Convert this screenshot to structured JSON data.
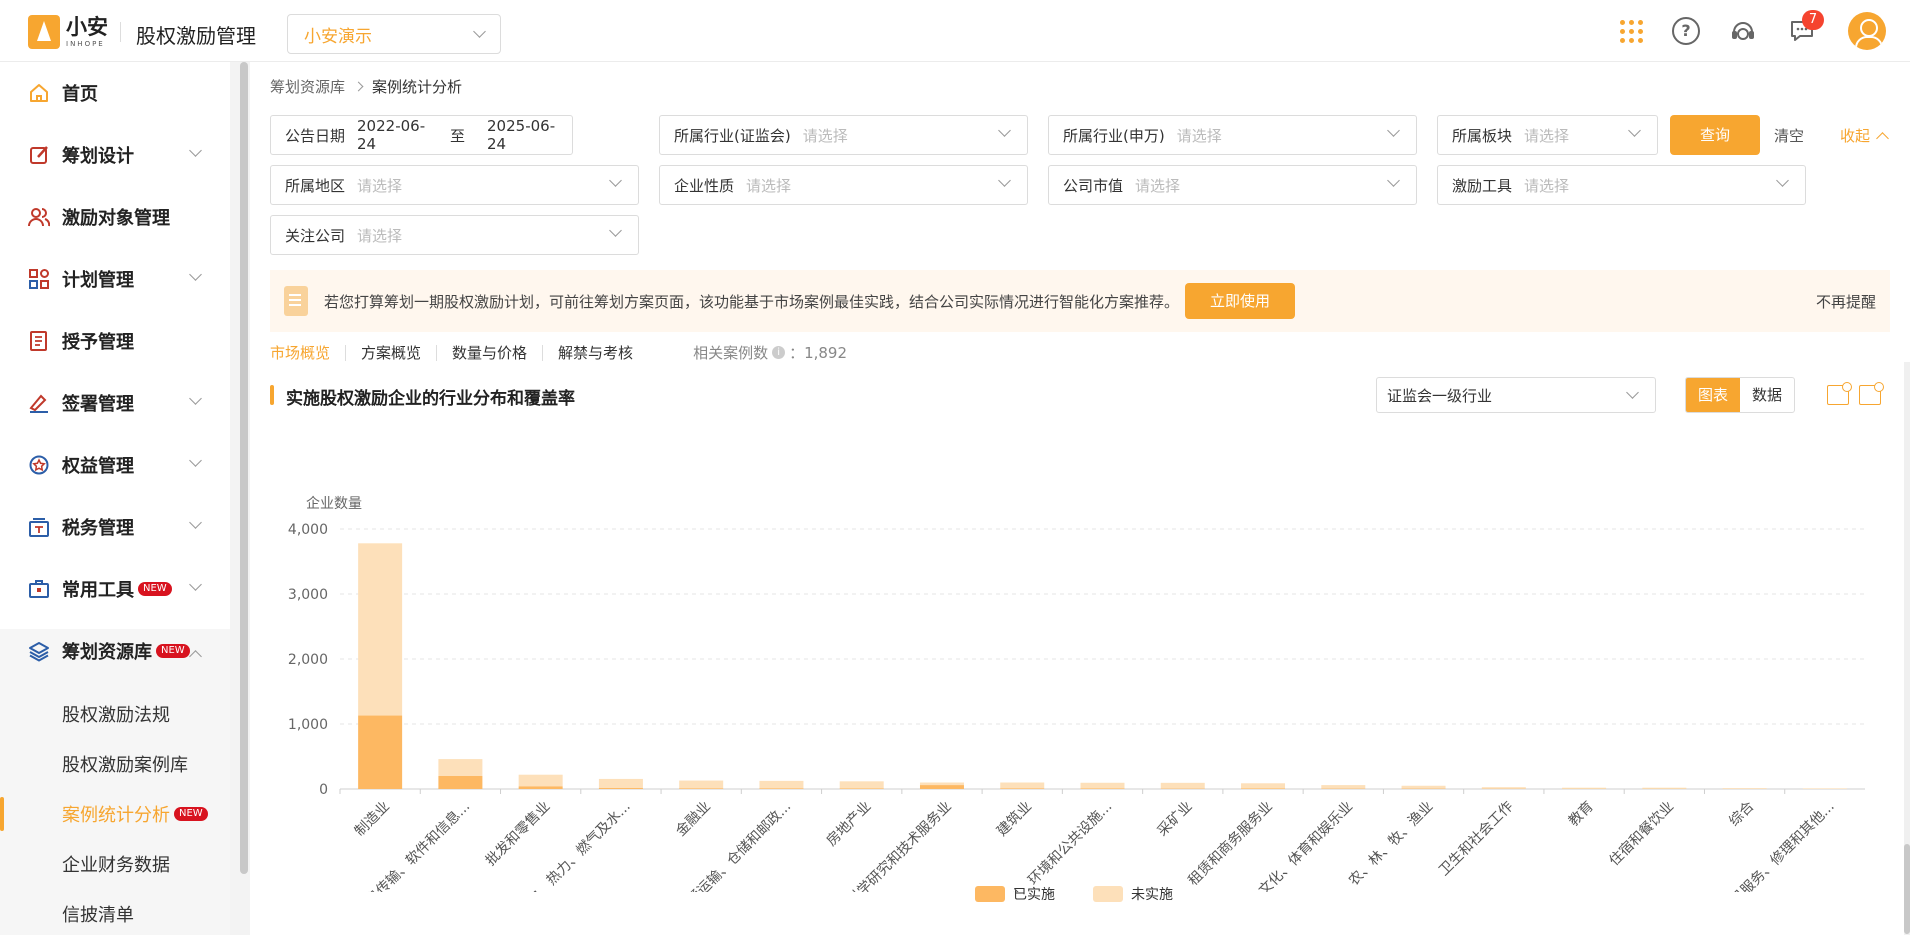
{
  "header": {
    "logo_text": "小安",
    "logo_sub": "INHOPE",
    "app_title": "股权激励管理",
    "company": "小安演示",
    "message_count": "7"
  },
  "sidebar": {
    "items": [
      {
        "label": "首页",
        "icon": "home-icon"
      },
      {
        "label": "筹划设计",
        "icon": "edit-icon"
      },
      {
        "label": "激励对象管理",
        "icon": "users-icon"
      },
      {
        "label": "计划管理",
        "icon": "grid-icon"
      },
      {
        "label": "授予管理",
        "icon": "book-icon"
      },
      {
        "label": "签署管理",
        "icon": "sign-icon"
      },
      {
        "label": "权益管理",
        "icon": "award-icon"
      },
      {
        "label": "税务管理",
        "icon": "tax-icon"
      },
      {
        "label": "常用工具",
        "icon": "toolbox-icon",
        "tag": "NEW"
      },
      {
        "label": "筹划资源库",
        "icon": "layers-icon",
        "tag": "NEW"
      }
    ],
    "sub_items": [
      {
        "label": "股权激励法规"
      },
      {
        "label": "股权激励案例库"
      },
      {
        "label": "案例统计分析",
        "tag": "NEW"
      },
      {
        "label": "企业财务数据"
      },
      {
        "label": "信披清单"
      }
    ]
  },
  "breadcrumb": [
    "筹划资源库",
    "案例统计分析"
  ],
  "filters": {
    "date_label": "公告日期",
    "date_from": "2022-06-24",
    "date_to_sep": "至",
    "date_to": "2025-06-24",
    "placeholder": "请选择",
    "industry_csrc": "所属行业(证监会)",
    "industry_sw": "所属行业(申万)",
    "board": "所属板块",
    "region": "所属地区",
    "nature": "企业性质",
    "market_cap": "公司市值",
    "tool": "激励工具",
    "follow": "关注公司",
    "query": "查询",
    "clear": "清空",
    "collapse": "收起"
  },
  "notice": {
    "text": "若您打算筹划一期股权激励计划，可前往筹划方案页面，该功能基于市场案例最佳实践，结合公司实际情况进行智能化方案推荐。",
    "button": "立即使用",
    "dismiss": "不再提醒"
  },
  "tabs": [
    "市场概览",
    "方案概览",
    "数量与价格",
    "解禁与考核"
  ],
  "case_count_label": "相关案例数",
  "case_count": "：1,892",
  "section": {
    "title": "实施股权激励企业的行业分布和覆盖率",
    "industry_select": "证监会一级行业",
    "toggle_chart": "图表",
    "toggle_data": "数据"
  },
  "colors": {
    "accent": "#f7a630",
    "implemented": "#fdb862",
    "not_implemented": "#fde0ba"
  },
  "chart_data": {
    "type": "bar",
    "stacked": true,
    "ylabel": "企业数量",
    "ylim": [
      0,
      4000
    ],
    "yticks": [
      "0",
      "1,000",
      "2,000",
      "3,000",
      "4,000"
    ],
    "categories": [
      "制造业",
      "信息传输、软件和信息...",
      "批发和零售业",
      "电力、热力、燃气及水...",
      "金融业",
      "交通运输、仓储和邮政...",
      "房地产业",
      "科学研究和技术服务业",
      "建筑业",
      "水利、环境和公共设施...",
      "采矿业",
      "租赁和商务服务业",
      "文化、体育和娱乐业",
      "农、林、牧、渔业",
      "卫生和社会工作",
      "教育",
      "住宿和餐饮业",
      "综合",
      "居民服务、修理和其他..."
    ],
    "series": [
      {
        "name": "已实施",
        "values": [
          1130,
          200,
          40,
          15,
          10,
          10,
          8,
          60,
          10,
          8,
          5,
          8,
          5,
          5,
          3,
          2,
          2,
          1,
          1
        ]
      },
      {
        "name": "未实施",
        "values": [
          2650,
          260,
          180,
          140,
          120,
          115,
          110,
          40,
          90,
          88,
          90,
          80,
          55,
          45,
          25,
          18,
          18,
          12,
          8
        ]
      }
    ],
    "legend": "bottom",
    "grid": true
  }
}
